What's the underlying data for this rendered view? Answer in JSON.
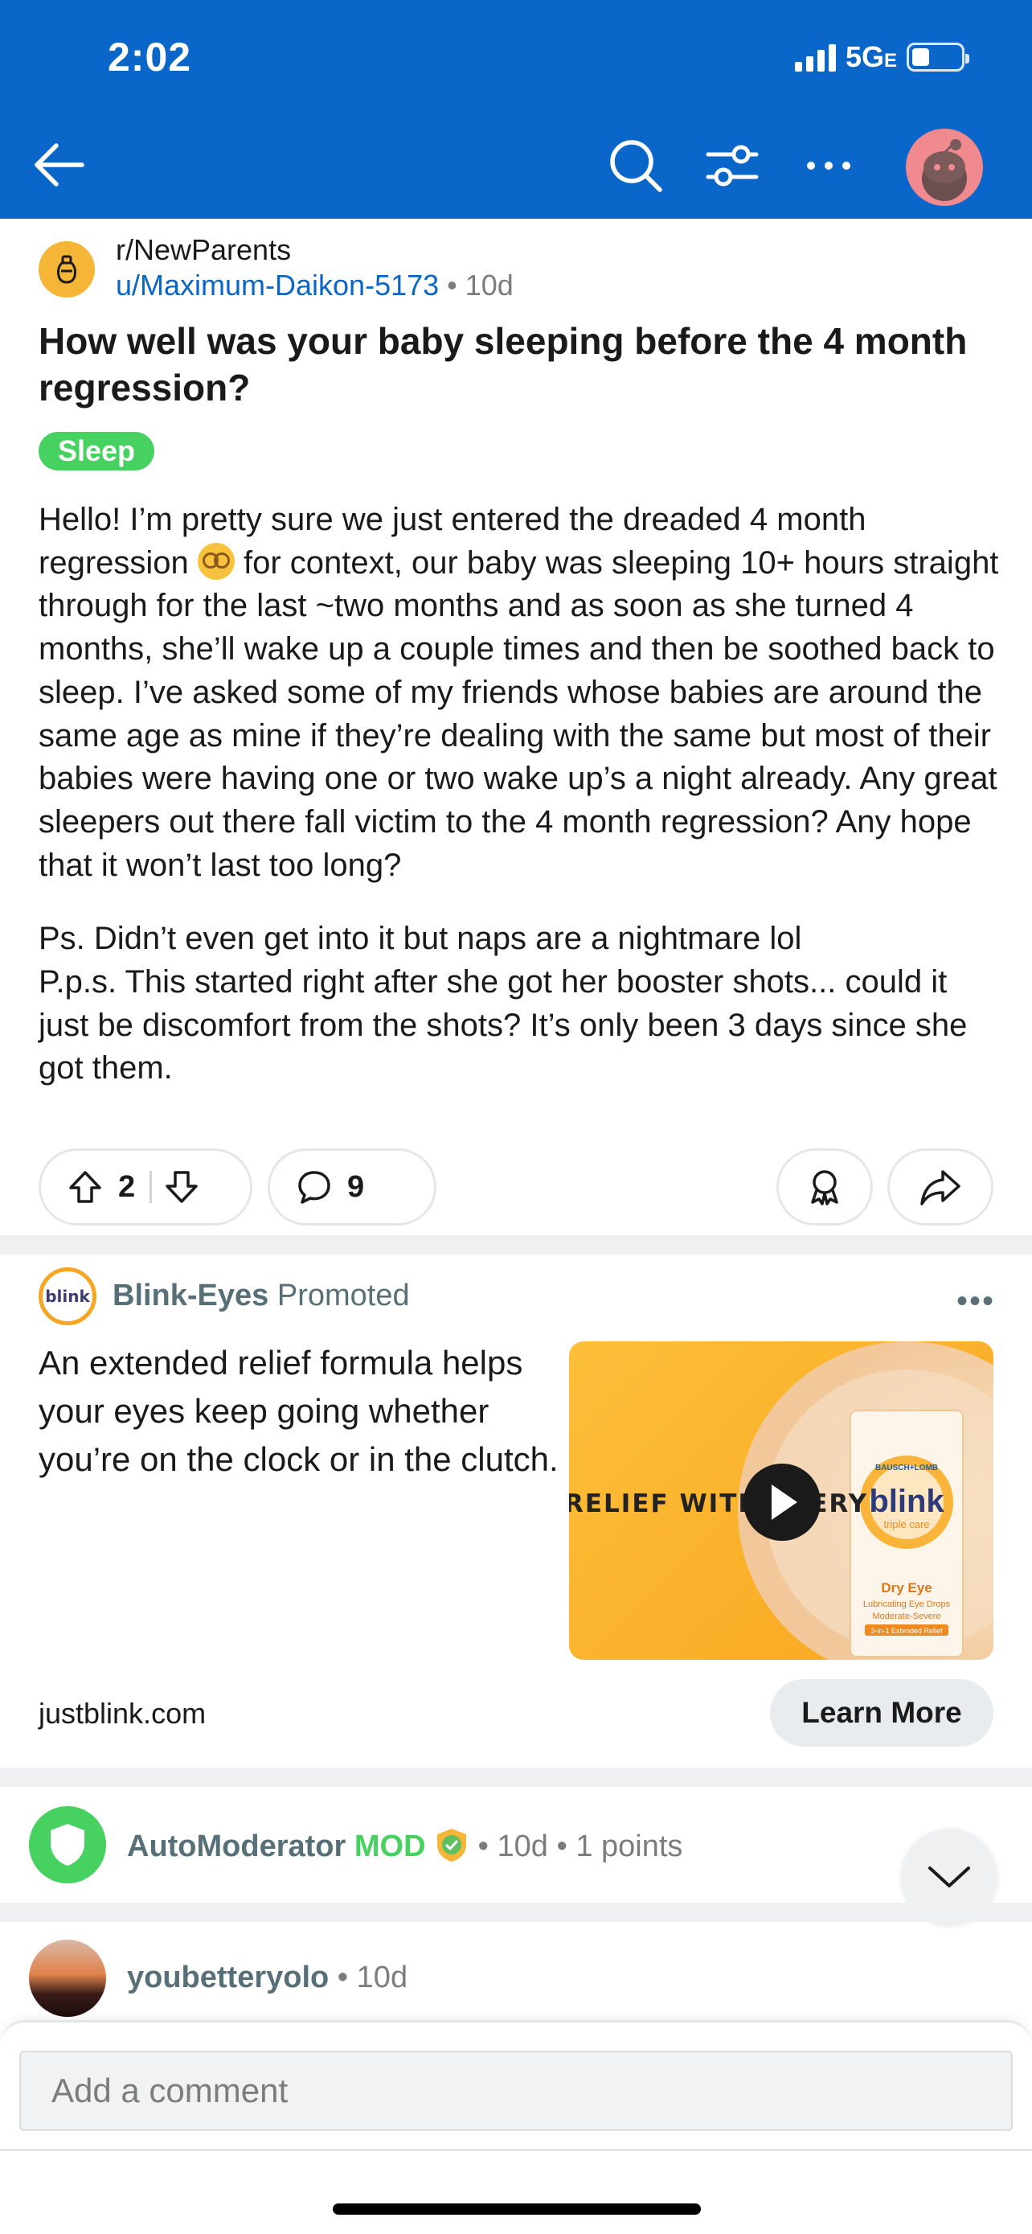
{
  "status_bar": {
    "time": "2:02",
    "network": "5G",
    "network_suffix": "E"
  },
  "post": {
    "subreddit": "r/NewParents",
    "author": "u/Maximum-Daikon-5173",
    "age": "10d",
    "title": "How well was your baby sleeping before the 4 month regression?",
    "flair": "Sleep",
    "body_p1_before_emoji": "Hello! I’m pretty sure we just entered the dreaded 4 month regression ",
    "body_p1_after_emoji": " for context, our baby was sleeping 10+ hours straight through for the last ~two months and as soon as she turned 4 months, she’ll wake up a couple times and then be soothed back to sleep. I’ve asked some of my friends whose babies are around the same age as mine if they’re dealing with the same but most of their babies were having one or two wake up’s a night already. Any great sleepers out there fall victim to the 4 month regression? Any hope that it won’t last too long?",
    "body_p2_line1": "Ps. Didn’t even get into it but naps are a nightmare lol",
    "body_p2_line2": "P.p.s. This started right after she got her booster shots... could it just be discomfort from the shots? It’s only been 3 days since she got them.",
    "upvotes": "2",
    "comments": "9"
  },
  "ad": {
    "brand": "Blink-Eyes",
    "promoted_label": "Promoted",
    "logo_text": "blink",
    "text": "An extended relief formula helps your eyes keep going whether you’re on the clock or in the clutch.",
    "image_banner": "RELIEF WITH EVERY",
    "box_brand": "BAUSCH+LOMB",
    "box_name": "blink",
    "box_sub": "triple care",
    "box_line1": "Dry Eye",
    "box_line2": "Lubricating Eye Drops",
    "box_line3": "Moderate-Severe",
    "box_line4": "3-in-1 Extended Relief",
    "url": "justblink.com",
    "cta": "Learn More",
    "more": "•••"
  },
  "comments_list": [
    {
      "user": "AutoModerator",
      "badge": "MOD",
      "age": "10d",
      "points": "1 points"
    },
    {
      "user": "youbetteryolo",
      "age": "10d"
    }
  ],
  "comment_box": {
    "placeholder": "Add a comment"
  },
  "colors": {
    "header_blue": "#0a66c8",
    "flair_green": "#46d160",
    "ad_orange": "#f8a51e"
  }
}
